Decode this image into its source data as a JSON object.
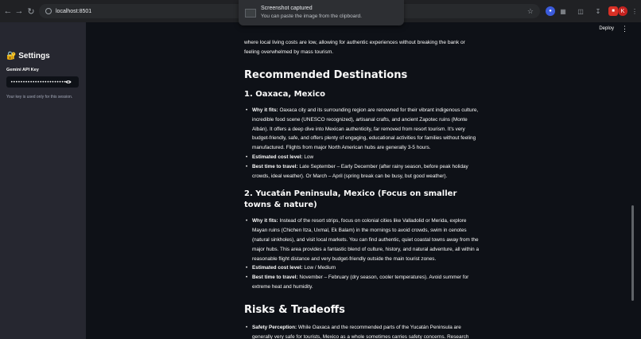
{
  "browser": {
    "url": "localhost:8501"
  },
  "toast": {
    "title": "Screenshot captured",
    "message": "You can paste the image from the clipboard."
  },
  "sidebar": {
    "title": "🔐 Settings",
    "api_label": "Gemini API Key",
    "api_value": "••••••••••••••••••••••••••••••••••••••",
    "note": "Your key is used only for this session."
  },
  "header": {
    "deploy_label": "Deploy",
    "menu_icon": "⋮"
  },
  "content": {
    "intro": "where local living costs are low, allowing for authentic experiences without breaking the bank or feeling overwhelmed by mass tourism.",
    "rec_heading": "Recommended Destinations",
    "dest1": {
      "title": "1. Oaxaca, Mexico",
      "why_label": "Why it fits:",
      "why_text": " Oaxaca city and its surrounding region are renowned for their vibrant indigenous culture, incredible food scene (UNESCO recognized), artisanal crafts, and ancient Zapotec ruins (Monte Albán). It offers a deep dive into Mexican authenticity, far removed from resort tourism. It's very budget-friendly, safe, and offers plenty of engaging, educational activities for families without feeling manufactured. Flights from major North American hubs are generally 3-5 hours.",
      "cost_label": "Estimated cost level:",
      "cost_text": " Low",
      "time_label": "Best time to travel:",
      "time_text": " Late September – Early December (after rainy season, before peak holiday crowds, ideal weather). Or March – April (spring break can be busy, but good weather)."
    },
    "dest2": {
      "title": "2. Yucatán Peninsula, Mexico (Focus on smaller towns & nature)",
      "why_label": "Why it fits:",
      "why_text": " Instead of the resort strips, focus on colonial cities like Valladolid or Merida, explore Mayan ruins (Chichen Itza, Uxmal, Ek Balam) in the mornings to avoid crowds, swim in cenotes (natural sinkholes), and visit local markets. You can find authentic, quiet coastal towns away from the major hubs. This area provides a fantastic blend of culture, history, and natural adventure, all within a reasonable flight distance and very budget-friendly outside the main tourist zones.",
      "cost_label": "Estimated cost level:",
      "cost_text": " Low / Medium",
      "time_label": "Best time to travel:",
      "time_text": " November – February (dry season, cooler temperatures). Avoid summer for extreme heat and humidity."
    },
    "risks_heading": "Risks & Tradeoffs",
    "risk1": {
      "label": "Safety Perception:",
      "text": " While Oaxaca and the recommended parts of the Yucatán Peninsula are generally very safe for tourists, Mexico as a whole sometimes carries safety concerns. Research specific regions"
    }
  }
}
